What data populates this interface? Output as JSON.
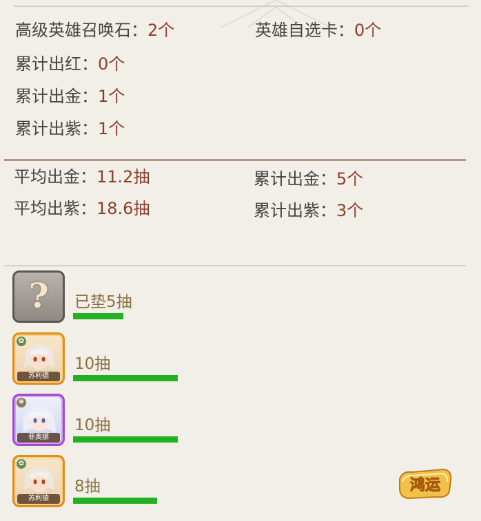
{
  "top_stats": {
    "hero_stone_label": "高级英雄召唤石：",
    "hero_stone_value": "2个",
    "select_card_label": "英雄自选卡：",
    "select_card_value": "0个",
    "red_label": "累计出红：",
    "red_value": "0个",
    "gold_label": "累计出金：",
    "gold_value": "1个",
    "purple_label": "累计出紫：",
    "purple_value": "1个"
  },
  "avg_stats": {
    "avg_gold_label": "平均出金：",
    "avg_gold_value": "11.2抽",
    "avg_purple_label": "平均出紫：",
    "avg_purple_value": "18.6抽",
    "total_gold_label": "累计出金：",
    "total_gold_value": "5个",
    "total_purple_label": "累计出紫：",
    "total_purple_value": "3个"
  },
  "history": [
    {
      "pulls": "已垫5抽",
      "portrait": "unknown",
      "progress": 0.48,
      "bar_color": "#23b123"
    },
    {
      "pulls": "10抽",
      "hero_name": "苏利德",
      "portrait": "gold",
      "progress": 1.0,
      "bar_color": "#23b123"
    },
    {
      "pulls": "10抽",
      "hero_name": "菲奥娜",
      "portrait": "purple",
      "progress": 1.0,
      "bar_color": "#23b123"
    },
    {
      "pulls": "8抽",
      "hero_name": "苏利德",
      "portrait": "gold",
      "progress": 0.8,
      "bar_color": "#23b123"
    }
  ],
  "luck_badge": {
    "text": "鸿运"
  },
  "colors": {
    "label": "#494443",
    "value": "#8b3e2c",
    "pulls_text": "#8c7241",
    "gold_border": "#e18c1e",
    "purple_border": "#a14ad3"
  },
  "icons": [
    "question-mark-icon",
    "hero-portrait-icon",
    "element-badge-icon",
    "luck-badge-icon"
  ]
}
